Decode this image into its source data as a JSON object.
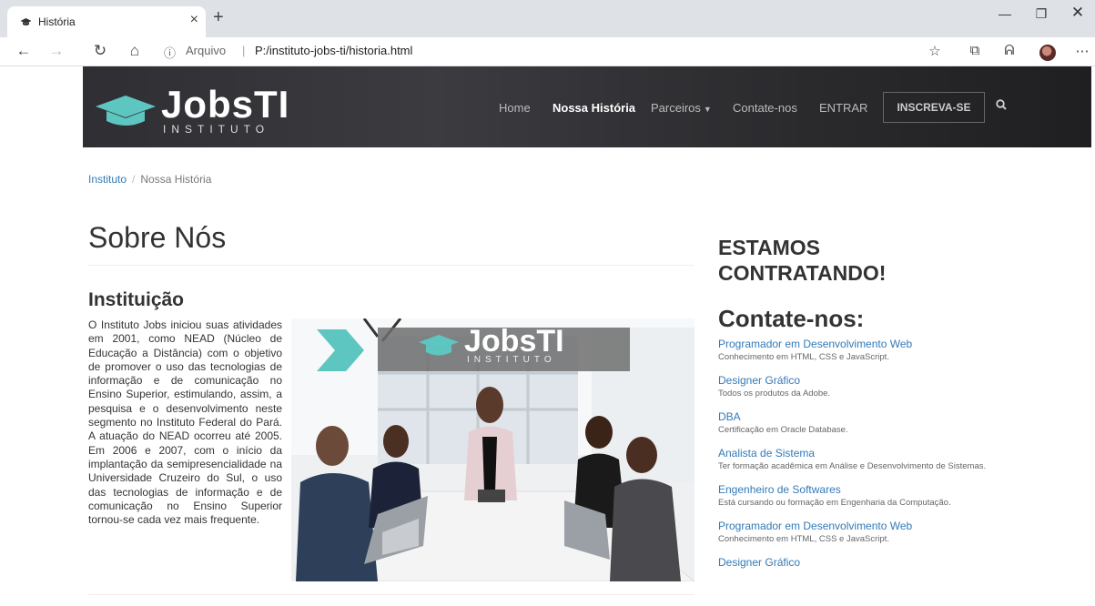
{
  "browser": {
    "tab_title": "História",
    "tab_close": "×",
    "new_tab": "+",
    "url_info": "ⓘ",
    "url_scheme": "Arquivo",
    "url_separator": "|",
    "url": "P:/instituto-jobs-ti/historia.html",
    "icons": [
      "back-icon",
      "forward-icon",
      "reload-icon",
      "home-icon",
      "info-icon",
      "favorite-star-icon",
      "collections-icon",
      "read-aloud-icon",
      "profile-avatar",
      "more-menu-icon"
    ],
    "window_controls": [
      "minimize",
      "restore",
      "close"
    ]
  },
  "site": {
    "logo_main": "JobsTI",
    "logo_sub": "INSTITUTO",
    "nav": [
      {
        "label": "Home",
        "active": false
      },
      {
        "label": "Nossa História",
        "active": true
      },
      {
        "label": "Parceiros",
        "dropdown": true
      },
      {
        "label": "Contate-nos",
        "active": false
      },
      {
        "label": "ENTRAR",
        "active": false
      }
    ],
    "cta": "INSCREVA-SE",
    "accent": "#337ab7",
    "logo_accent": "#5ec6c0"
  },
  "breadcrumb": {
    "home": "Instituto",
    "separator": "/",
    "current": "Nossa História"
  },
  "main": {
    "title": "Sobre Nós",
    "section_title": "Instituição",
    "body": "O Instituto Jobs iniciou suas atividades em 2001, como NEAD (Núcleo de Educação a Distância) com o objetivo de promover o uso das tecnologias de informação e de comunicação no Ensino Superior, estimulando, assim, a pesquisa e o desenvolvimento neste segmento no Instituto Federal do Pará. A atuação do NEAD ocorreu até 2005. Em 2006 e 2007, com o início da implantação da semipresencialidade na Universidade Cruzeiro do Sul, o uso das tecnologias de informação e de comunicação no Ensino Superior tornou-se cada vez mais frequente.",
    "image_logo_main": "JobsTI",
    "image_logo_sub": "INSTITUTO"
  },
  "sidebar": {
    "hiring_title": "ESTAMOS CONTRATANDO!",
    "contact_title": "Contate-nos:",
    "jobs": [
      {
        "title": "Programador em Desenvolvimento Web",
        "desc": "Conhecimento em HTML, CSS e JavaScript."
      },
      {
        "title": "Designer Gráfico",
        "desc": "Todos os produtos da Adobe."
      },
      {
        "title": "DBA",
        "desc": "Certificação em Oracle Database."
      },
      {
        "title": "Analista de Sistema",
        "desc": "Ter formação acadêmica em Análise e Desenvolvimento de Sistemas."
      },
      {
        "title": "Engenheiro de Softwares",
        "desc": "Está cursando ou formação em Engenharia da Computação."
      },
      {
        "title": "Programador em Desenvolvimento Web",
        "desc": "Conhecimento em HTML, CSS e JavaScript."
      },
      {
        "title": "Designer Gráfico",
        "desc": ""
      }
    ]
  }
}
